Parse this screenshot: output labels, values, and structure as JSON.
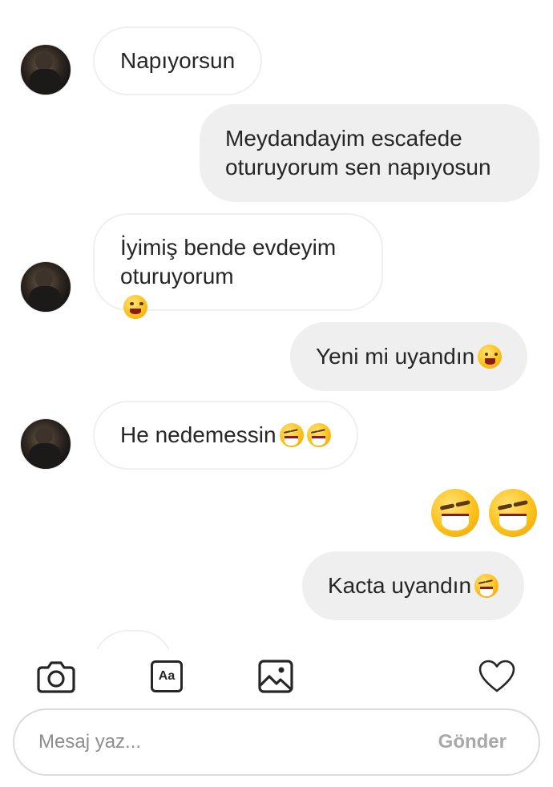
{
  "messages": [
    {
      "side": "in",
      "text": "Napıyorsun"
    },
    {
      "side": "out",
      "text": "Meydandayim escafede\noturuyorum sen napıyosun"
    },
    {
      "side": "in",
      "text": "İyimiş bende evdeyim\noturuyorum"
    },
    {
      "side": "out",
      "text": "Yeni mi uyandın"
    },
    {
      "side": "in",
      "text": "He nedemessin"
    },
    {
      "side": "out",
      "text": ""
    },
    {
      "side": "out",
      "text": "Kacta uyandın"
    }
  ],
  "emojis": {
    "message_3": "grinning-face-emoji",
    "message_4": "grinning-face-emoji",
    "message_5": [
      "face-with-tears-of-joy-emoji",
      "face-with-tears-of-joy-emoji"
    ],
    "message_6": [
      "face-with-tears-of-joy-emoji",
      "face-with-tears-of-joy-emoji"
    ],
    "message_7": "face-with-tears-of-joy-emoji"
  },
  "toolbar": {
    "camera_icon": "camera-icon",
    "text_style_label": "Aa",
    "gallery_icon": "image-icon",
    "like_icon": "heart-icon"
  },
  "composer": {
    "placeholder": "Mesaj yaz...",
    "send_label": "Gönder"
  },
  "colors": {
    "incoming_bubble_border": "#efefef",
    "outgoing_bubble_bg": "#efefef",
    "text": "#262626",
    "placeholder": "#8e8e8e",
    "send_disabled": "#a8a8a8"
  }
}
